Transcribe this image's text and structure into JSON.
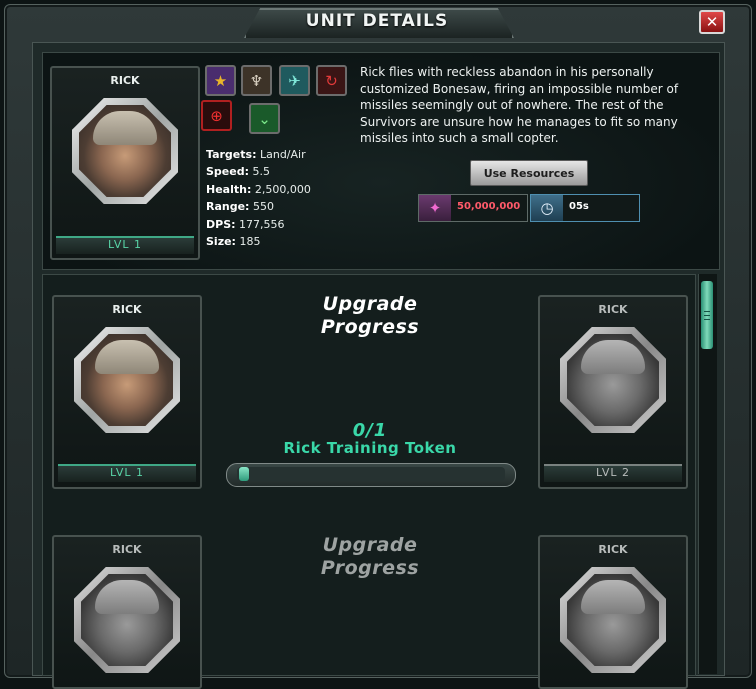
{
  "window": {
    "title": "UNIT DETAILS",
    "close_label": "✕"
  },
  "unit": {
    "name": "RICK",
    "level_label": "LVL 1",
    "description": "Rick flies with reckless abandon in his personally customized Bonesaw, firing an impossible number of missiles seemingly out of nowhere. The rest of the Survivors are unsure how he manages to fit so many missiles into such a small copter.",
    "stats": [
      {
        "label": "Targets:",
        "value": "Land/Air"
      },
      {
        "label": "Speed:",
        "value": "5.5"
      },
      {
        "label": "Health:",
        "value": "2,500,000"
      },
      {
        "label": "Range:",
        "value": "550"
      },
      {
        "label": "DPS:",
        "value": "177,556"
      },
      {
        "label": "Size:",
        "value": "185"
      }
    ],
    "trait_icons": [
      "star-badge-icon",
      "winged-emblem-icon",
      "aircraft-icon",
      "cycle-icon",
      "crosshair-icon",
      "chevron-rank-icon"
    ]
  },
  "upgrade": {
    "use_resources_label": "Use Resources",
    "resource_cost": "50,000,000",
    "time_cost": "05s",
    "progress_title": "Upgrade Progress",
    "progress_count": "0/1",
    "progress_fraction": 0.0,
    "token_label": "Rick Training Token",
    "current_card": {
      "name": "RICK",
      "level_label": "LVL 1"
    },
    "next_card": {
      "name": "RICK",
      "level_label": "LVL 2"
    },
    "locked_title": "Upgrade Progress",
    "locked_left": {
      "name": "RICK"
    },
    "locked_right": {
      "name": "RICK"
    }
  },
  "colors": {
    "accent_green": "#3ad8a9",
    "resource_red": "#e04a5a",
    "close_red": "#c62828"
  }
}
